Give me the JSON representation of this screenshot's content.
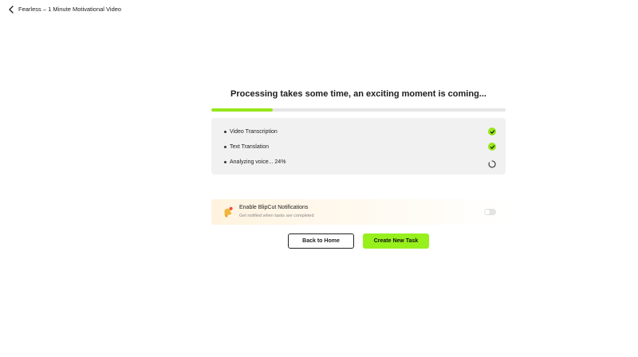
{
  "header": {
    "title": "Fearless – 1 Minute Motivational Video",
    "back_icon": "chevron-left-icon"
  },
  "processing": {
    "headline": "Processing takes some time, an exciting moment is coming...",
    "progress_fraction": 0.21,
    "steps": [
      {
        "label": "Video Transcription",
        "status": "done"
      },
      {
        "label": "Text Translation",
        "status": "done"
      },
      {
        "label": "Analyzing voice... 24%",
        "status": "in-progress"
      }
    ]
  },
  "notification": {
    "title": "Enable BlipCut Notifications",
    "subtitle": "Get notified when tasks are completed",
    "enabled": false,
    "icon": "bell-icon"
  },
  "actions": {
    "back_home_label": "Back to Home",
    "create_task_label": "Create New Task"
  },
  "colors": {
    "accent": "#97e51c",
    "button_accent": "#97f01c",
    "panel_bg": "#f1f1f1"
  }
}
